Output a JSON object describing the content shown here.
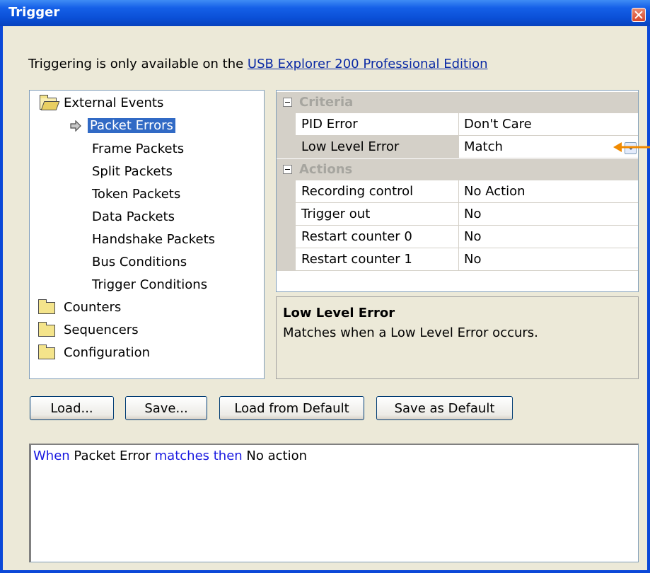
{
  "window": {
    "title": "Trigger"
  },
  "notice": {
    "text": "Triggering is only available on the ",
    "link": "USB Explorer 200 Professional Edition"
  },
  "tree": {
    "external_events": "External Events",
    "children": [
      "Packet Errors",
      "Frame Packets",
      "Split Packets",
      "Token Packets",
      "Data Packets",
      "Handshake Packets",
      "Bus Conditions",
      "Trigger Conditions"
    ],
    "counters": "Counters",
    "sequencers": "Sequencers",
    "configuration": "Configuration"
  },
  "props": {
    "criteria": {
      "label": "Criteria",
      "rows": [
        {
          "name": "PID Error",
          "value": "Don't Care"
        },
        {
          "name": "Low Level Error",
          "value": "Match"
        }
      ]
    },
    "actions": {
      "label": "Actions",
      "rows": [
        {
          "name": "Recording control",
          "value": "No Action"
        },
        {
          "name": "Trigger out",
          "value": "No"
        },
        {
          "name": "Restart counter 0",
          "value": "No"
        },
        {
          "name": "Restart counter 1",
          "value": "No"
        }
      ]
    }
  },
  "description": {
    "title": "Low Level Error",
    "text": "Matches when a Low Level Error occurs."
  },
  "buttons": {
    "load": "Load...",
    "save": "Save...",
    "load_default": "Load from Default",
    "save_default": "Save as Default"
  },
  "log": {
    "when": "When",
    "subject": " Packet Error ",
    "matches": "matches then",
    "action": " No action"
  },
  "colors": {
    "titlebar": "#0a4fd6",
    "selection": "#316ac5",
    "callout": "#f08a00",
    "keyword": "#1a1ae0"
  },
  "icons": [
    "close-icon",
    "folder-open-icon",
    "folder-icon",
    "arrow-right-icon",
    "collapse-icon",
    "dropdown-arrow-icon"
  ]
}
